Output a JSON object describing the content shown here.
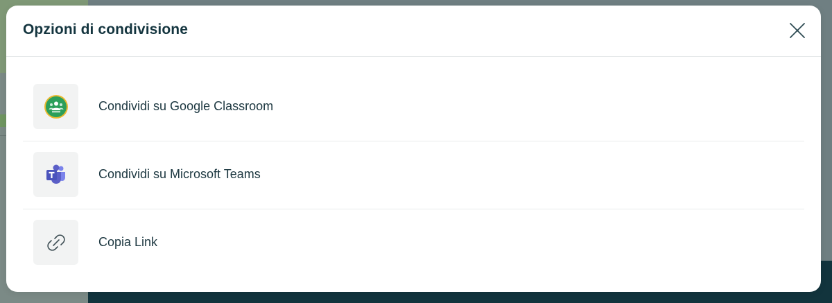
{
  "modal": {
    "title": "Opzioni di condivisione",
    "close_icon": "close-icon"
  },
  "options": [
    {
      "label": "Condividi su Google Classroom",
      "icon": "google-classroom-icon"
    },
    {
      "label": "Condividi su Microsoft Teams",
      "icon": "microsoft-teams-icon"
    },
    {
      "label": "Copia Link",
      "icon": "link-icon"
    }
  ],
  "colors": {
    "title": "#14353f",
    "overlay": "#6f7f82",
    "footer": "#12343d",
    "classroom_green": "#2b9f5a",
    "classroom_ring": "#e9b92f",
    "teams_purple": "#5b5fc7"
  }
}
